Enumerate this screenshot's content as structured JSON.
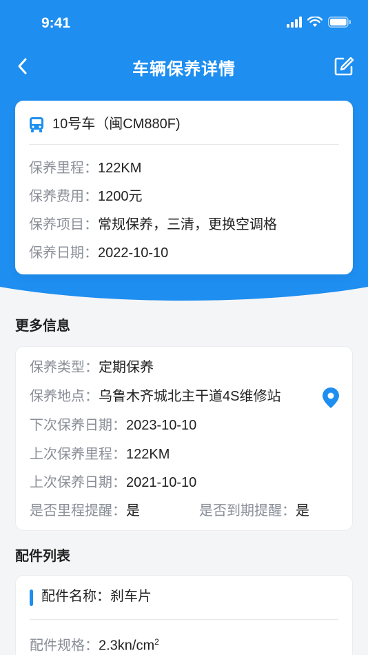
{
  "status_bar": {
    "time": "9:41"
  },
  "nav": {
    "title": "车辆保养详情"
  },
  "summary": {
    "car_name": "10号车（闽CM880F)",
    "rows": [
      {
        "label": "保养里程：",
        "value": "122KM"
      },
      {
        "label": "保养费用：",
        "value": "1200元"
      },
      {
        "label": "保养项目：",
        "value": "常规保养，三清，更换空调格"
      },
      {
        "label": "保养日期：",
        "value": "2022-10-10"
      }
    ]
  },
  "more_info": {
    "title": "更多信息",
    "rows": [
      {
        "label": "保养类型：",
        "value": "定期保养"
      },
      {
        "label": "保养地点：",
        "value": "乌鲁木齐城北主干道4S维修站"
      },
      {
        "label": "下次保养日期：",
        "value": "2023-10-10"
      },
      {
        "label": "上次保养里程：",
        "value": "122KM"
      },
      {
        "label": "上次保养日期：",
        "value": "2021-10-10"
      }
    ],
    "mileage_reminder": {
      "label": "是否里程提醒：",
      "value": "是"
    },
    "expiry_reminder": {
      "label": "是否到期提醒：",
      "value": "是"
    }
  },
  "parts": {
    "title": "配件列表",
    "items": [
      {
        "name_label": "配件名称：",
        "name_value": "刹车片",
        "spec_label": "配件规格：",
        "spec_value": "2.3kn/cm",
        "spec_sup": "2"
      }
    ]
  },
  "colors": {
    "primary": "#1e8ef0",
    "background": "#f4f5f7",
    "label_gray": "#8a8f98"
  },
  "icons": [
    "back-arrow-icon",
    "edit-icon",
    "bus-icon",
    "location-pin-icon",
    "signal-icon",
    "wifi-icon",
    "battery-icon"
  ]
}
